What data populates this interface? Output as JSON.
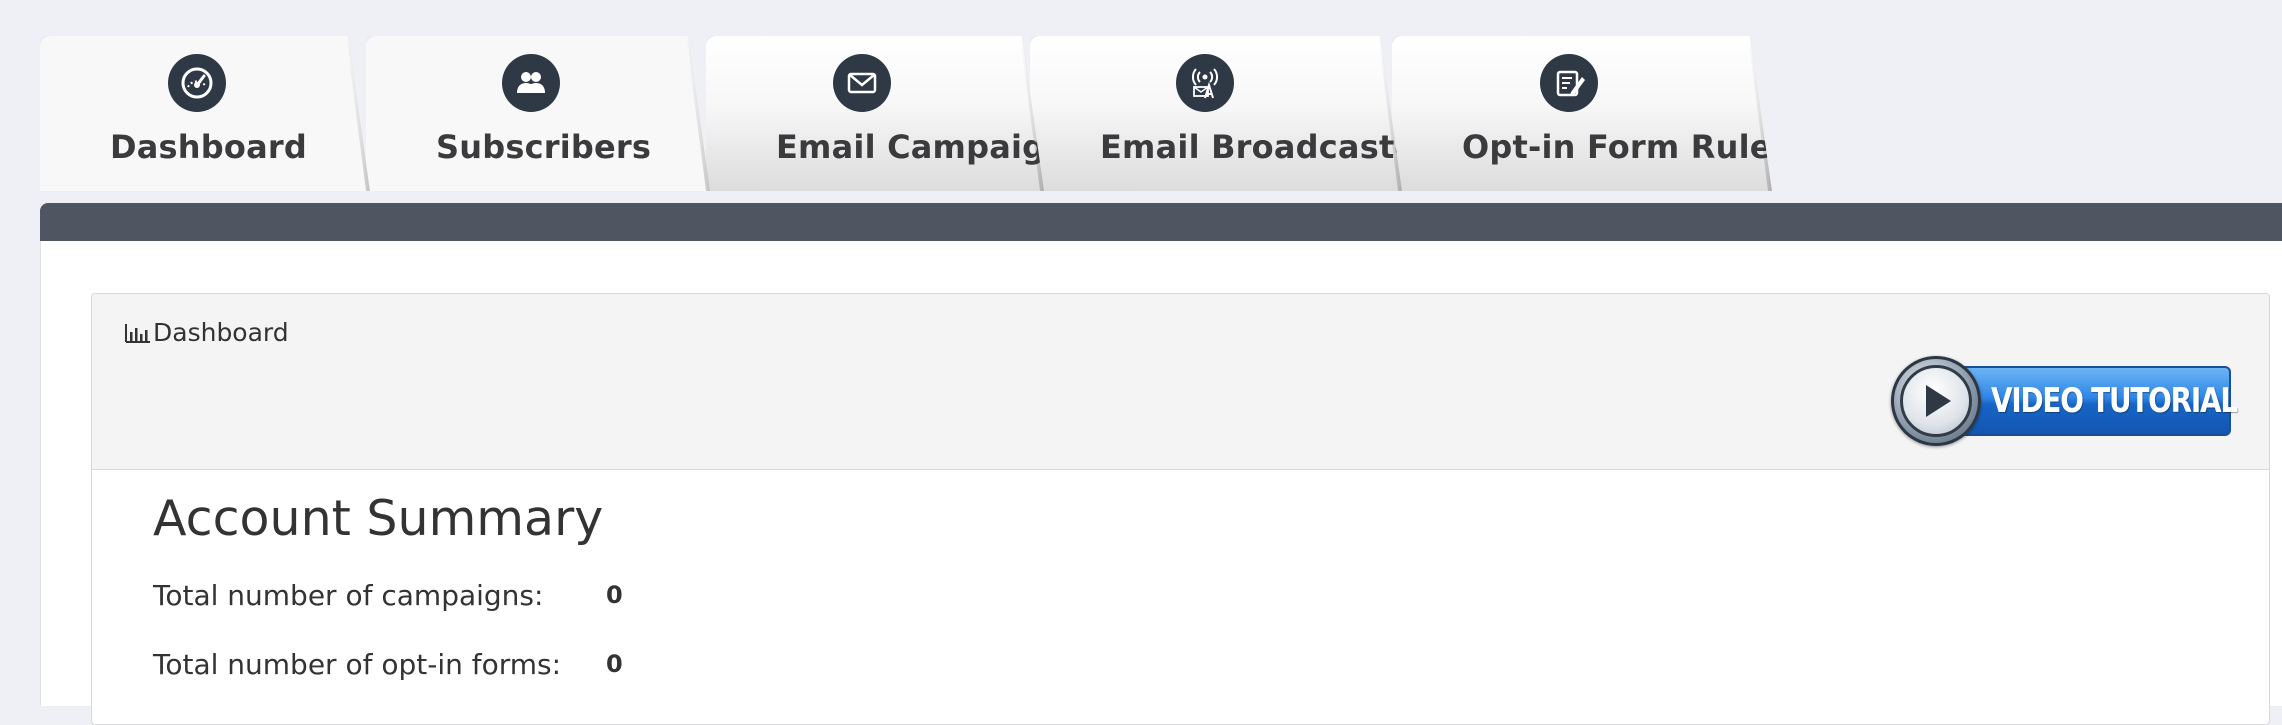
{
  "tabs": [
    {
      "label": "Dashboard",
      "icon": "gauge-icon",
      "active": true
    },
    {
      "label": "Subscribers",
      "icon": "users-icon",
      "active": true
    },
    {
      "label": "Email Campaign",
      "icon": "envelope-icon",
      "active": false
    },
    {
      "label": "Email Broadcaster",
      "icon": "broadcast-icon",
      "active": false
    },
    {
      "label": "Opt-in Form Rules",
      "icon": "form-edit-icon",
      "active": false
    }
  ],
  "panel": {
    "title": "Dashboard",
    "title_icon": "bar-chart-icon",
    "video_button_label": "VIDEO TUTORIAL"
  },
  "summary": {
    "heading": "Account Summary",
    "rows": [
      {
        "label": "Total number of campaigns:",
        "value": "0"
      },
      {
        "label": "Total number of opt-in forms:",
        "value": "0"
      }
    ]
  },
  "colors": {
    "icon_circle": "#2f3845",
    "nav_bar": "#4f5561",
    "video_button": "#2e86e6"
  }
}
